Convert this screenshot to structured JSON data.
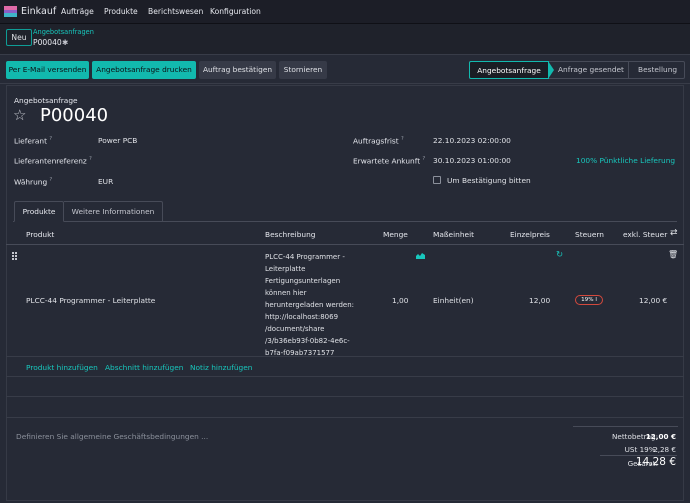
{
  "navbar": {
    "app": "Einkauf",
    "menu": [
      "Aufträge",
      "Produkte",
      "Berichtswesen",
      "Konfiguration"
    ]
  },
  "control": {
    "new_button": "Neu",
    "breadcrumb_parent": "Angebotsanfragen",
    "breadcrumb_current": "P00040"
  },
  "actions": {
    "email": "Per E-Mail versenden",
    "print": "Angebotsanfrage drucken",
    "confirm": "Auftrag bestätigen",
    "cancel": "Stornieren"
  },
  "statusbar": {
    "steps": [
      "Angebotsanfrage",
      "Anfrage gesendet",
      "Bestellung"
    ],
    "active": "Angebotsanfrage"
  },
  "form": {
    "doc_type": "Angebotsanfrage",
    "doc_number": "P00040",
    "fields_left": [
      {
        "label": "Lieferant",
        "value": "Power PCB"
      },
      {
        "label": "Lieferantenreferenz",
        "value": ""
      },
      {
        "label": "Währung",
        "value": "EUR"
      }
    ],
    "fields_right": [
      {
        "label": "Auftragsfrist",
        "value": "22.10.2023 02:00:00"
      },
      {
        "label": "Erwartete Ankunft",
        "value": "30.10.2023 01:00:00",
        "extra": "100% Pünktliche Lieferung"
      }
    ],
    "checkbox_label": "Um Bestätigung bitten"
  },
  "tabs": [
    "Produkte",
    "Weitere Informationen"
  ],
  "table": {
    "headers": [
      "Produkt",
      "Beschreibung",
      "Menge",
      "Maßeinheit",
      "Einzelpreis",
      "Steuern",
      "exkl. Steuer"
    ],
    "row": {
      "product": "PLCC-44 Programmer - Leiterplatte",
      "description": [
        "PLCC-44 Programmer -",
        "Leiterplatte",
        "Fertigungsunterlagen",
        "können hier",
        "heruntergeladen werden:",
        "http://localhost:8069",
        "/document/share",
        "/3/b36eb93f-0b82-4e6c-",
        "b7fa-f09ab7371577"
      ],
      "qty": "1,00",
      "uom": "Einheit(en)",
      "price": "12,00",
      "tax": "19% l",
      "subtotal": "12,00 €"
    },
    "add_links": [
      "Produkt hinzufügen",
      "Abschnitt hinzufügen",
      "Notiz hinzufügen"
    ]
  },
  "terms_placeholder": "Definieren Sie allgemeine Geschäftsbedingungen ...",
  "totals": {
    "net_label": "Nettobetrag:",
    "net_value": "12,00 €",
    "tax_label": "USt 19%:",
    "tax_value": "2,28 €",
    "total_label": "Gesamt:",
    "total_value": "14,28 €"
  },
  "colors": {
    "accent": "#12b9ae",
    "link": "#18c7bd",
    "danger": "#d4493d",
    "background": "#262a36"
  }
}
